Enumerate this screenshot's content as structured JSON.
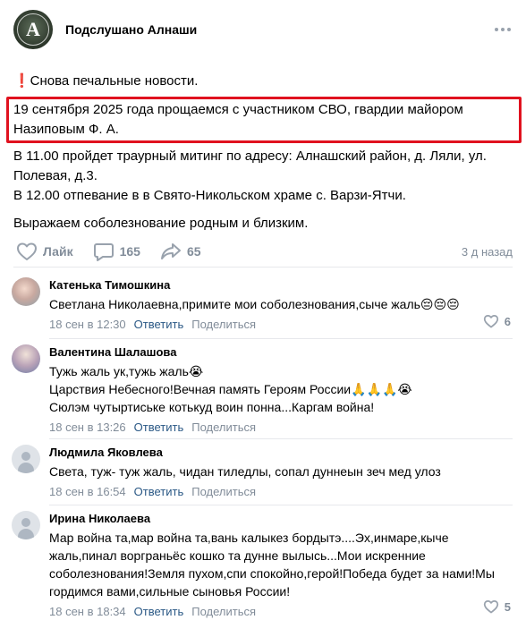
{
  "group": {
    "name": "Подслушано Алнаши",
    "avatar_letter": "А",
    "avatar_text": "Подслушано Алнаши"
  },
  "post": {
    "line1": "❗Снова печальные новости.",
    "line2": "19 сентября 2025 года прощаемся с участником СВО, гвардии майором\nНазиповым Ф. А.",
    "line3": "В 11.00 пройдет траурный митинг по адресу: Алнашский район, д. Ляли, ул.\nПолевая, д.3.\nВ 12.00 отпевание в в Свято-Никольском храме с. Варзи-Ятчи.",
    "line4": "Выражаем соболезнование родным и близким."
  },
  "actions": {
    "like_label": "Лайк",
    "comments_count": "165",
    "shares_count": "65",
    "time_ago": "3 д назад"
  },
  "colors": {
    "accent_link": "#2a5885",
    "muted": "#818c99",
    "highlight_border": "#e0121f"
  },
  "comments": [
    {
      "author": "Катенька Тимошкина",
      "text": "Светлана Николаевна,примите мои соболезнования,сыче жаль😔😔😔",
      "date": "18 сен в 12:30",
      "reply": "Ответить",
      "share": "Поделиться",
      "likes": "6"
    },
    {
      "author": "Валентина Шалашова",
      "text": "Тужь жаль ук,тужь жаль😭\nЦарствия Небесного!Вечная память Героям России🙏🙏🙏😭\nСюлэм чутыртиське котькуд воин понна...Каргам война!",
      "date": "18 сен в 13:26",
      "reply": "Ответить",
      "share": "Поделиться",
      "likes": ""
    },
    {
      "author": "Людмила Яковлева",
      "text": "Света, туж- туж жаль, чидан тиледлы, сопал дуннеын зеч мед улоз",
      "date": "18 сен в 16:54",
      "reply": "Ответить",
      "share": "Поделиться",
      "likes": ""
    },
    {
      "author": "Ирина Николаева",
      "text": "Мар война та,мар война та,вань калыкез бордытэ....Эх,инмаре,кыче\nжаль,пинал ворграньёс кошко та дунне вылысь...Мои искренние\nсоболезнования!Земля пухом,спи спокойно,герой!Победа будет за нами!Мы\nгордимся вами,сильные сыновья России!",
      "date": "18 сен в 18:34",
      "reply": "Ответить",
      "share": "Поделиться",
      "likes": "5"
    }
  ]
}
